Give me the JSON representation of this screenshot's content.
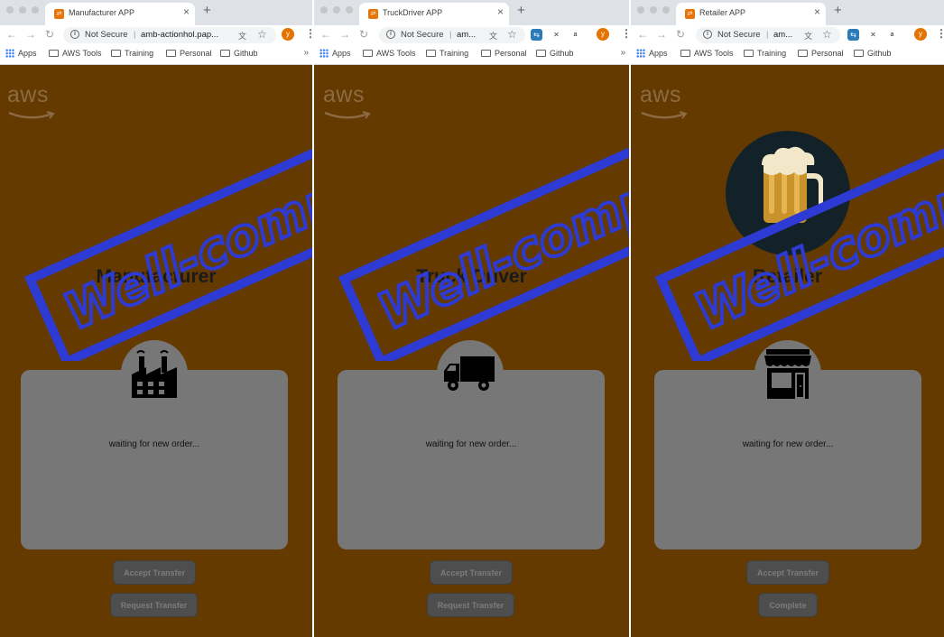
{
  "windows": [
    {
      "tab_title": "Manufacturer APP",
      "url_secure": "Not Secure",
      "url": "amb-actionhol.pap...",
      "role": "Manufacturer",
      "status": "waiting for new order...",
      "buttons": [
        "Accept Transfer",
        "Request Transfer"
      ],
      "role_icon": "factory-icon"
    },
    {
      "tab_title": "TruckDriver APP",
      "url_secure": "Not Secure",
      "url": "am...",
      "role": "Truck Driver",
      "status": "waiting for new order...",
      "buttons": [
        "Accept Transfer",
        "Request Transfer"
      ],
      "role_icon": "truck-icon"
    },
    {
      "tab_title": "Retailer APP",
      "url_secure": "Not Secure",
      "url": "am...",
      "role": "Retailer",
      "status": "waiting for new order...",
      "buttons": [
        "Accept Transfer",
        "Complete"
      ],
      "role_icon": "store-icon",
      "hero_icon": "beer-mug-icon"
    }
  ],
  "bookmarks": [
    "Apps",
    "AWS Tools",
    "Training",
    "Personal",
    "Github"
  ],
  "logo": "aws",
  "avatar_initial": "y",
  "stamp_text": "Well-complet",
  "colors": {
    "page_bg": "#643a00",
    "panel": "#777777",
    "stamp": "#2d3bd4",
    "favicon": "#e8740c"
  }
}
